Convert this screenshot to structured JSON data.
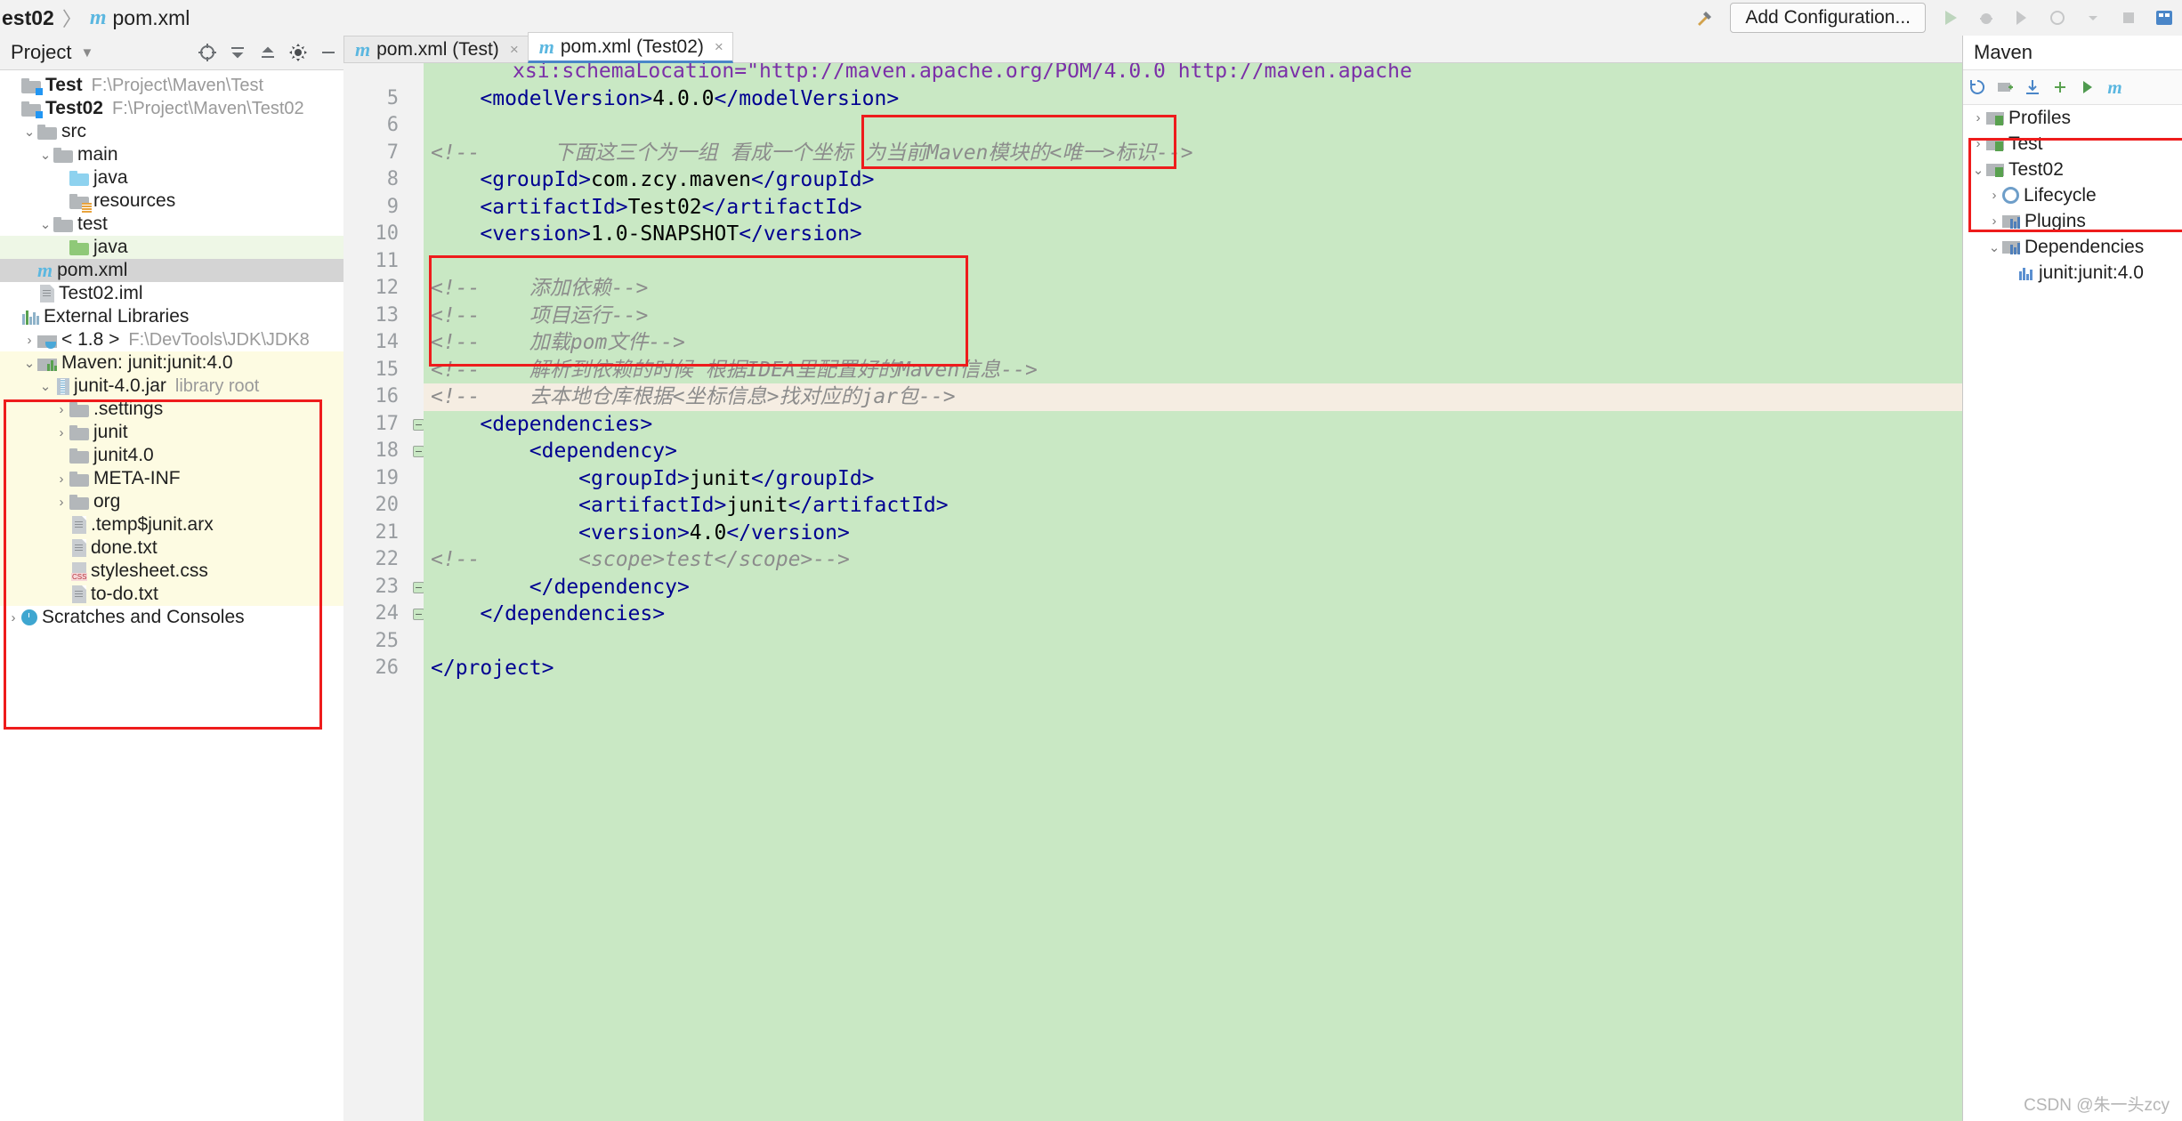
{
  "window": {
    "breadcrumb": {
      "project": "est02",
      "separator": "〉",
      "file": "pom.xml",
      "file_icon": "maven-m-icon"
    },
    "add_configuration_label": "Add Configuration...",
    "watermark": "CSDN @朱一头zcy"
  },
  "project_panel": {
    "title": "Project",
    "tree": [
      {
        "label": "Test",
        "path": "F:\\Project\\Maven\\Test",
        "icon": "module-folder-icon",
        "indent": 0,
        "arrow": "",
        "bold": true
      },
      {
        "label": "Test02",
        "path": "F:\\Project\\Maven\\Test02",
        "icon": "module-folder-icon",
        "indent": 0,
        "arrow": "",
        "bold": true
      },
      {
        "label": "src",
        "path": "",
        "icon": "folder-grey-icon",
        "indent": 1,
        "arrow": "⌄",
        "bold": false
      },
      {
        "label": "main",
        "path": "",
        "icon": "folder-grey-icon",
        "indent": 2,
        "arrow": "⌄",
        "bold": false
      },
      {
        "label": "java",
        "path": "",
        "icon": "folder-blue-icon",
        "indent": 3,
        "arrow": "",
        "bold": false
      },
      {
        "label": "resources",
        "path": "",
        "icon": "folder-resources-icon",
        "indent": 3,
        "arrow": "",
        "bold": false
      },
      {
        "label": "test",
        "path": "",
        "icon": "folder-grey-icon",
        "indent": 2,
        "arrow": "⌄",
        "bold": false
      },
      {
        "label": "java",
        "path": "",
        "icon": "folder-green-icon",
        "indent": 3,
        "arrow": "",
        "bold": false,
        "highlight": "green"
      },
      {
        "label": "pom.xml",
        "path": "",
        "icon": "maven-m-icon",
        "indent": 1,
        "arrow": "",
        "bold": false,
        "highlight": "grey"
      },
      {
        "label": "Test02.iml",
        "path": "",
        "icon": "iml-file-icon",
        "indent": 1,
        "arrow": "",
        "bold": false
      },
      {
        "label": "External Libraries",
        "path": "",
        "icon": "library-icon",
        "indent": 0,
        "arrow": "",
        "bold": false
      },
      {
        "label": "< 1.8 >",
        "path": "F:\\DevTools\\JDK\\JDK8",
        "icon": "jdk-icon",
        "indent": 1,
        "arrow": "›",
        "bold": false
      },
      {
        "label": "Maven: junit:junit:4.0",
        "path": "",
        "icon": "maven-lib-icon",
        "indent": 1,
        "arrow": "⌄",
        "bold": false,
        "highlight": "yellow"
      },
      {
        "label": "junit-4.0.jar",
        "path": "library root",
        "icon": "jar-icon",
        "indent": 2,
        "arrow": "⌄",
        "bold": false,
        "highlight": "yellow"
      },
      {
        "label": ".settings",
        "path": "",
        "icon": "folder-grey-icon",
        "indent": 3,
        "arrow": "›",
        "bold": false,
        "highlight": "yellow"
      },
      {
        "label": "junit",
        "path": "",
        "icon": "folder-grey-icon",
        "indent": 3,
        "arrow": "›",
        "bold": false,
        "highlight": "yellow"
      },
      {
        "label": "junit4.0",
        "path": "",
        "icon": "folder-grey-icon",
        "indent": 3,
        "arrow": "",
        "bold": false,
        "highlight": "yellow"
      },
      {
        "label": "META-INF",
        "path": "",
        "icon": "folder-grey-icon",
        "indent": 3,
        "arrow": "›",
        "bold": false,
        "highlight": "yellow"
      },
      {
        "label": "org",
        "path": "",
        "icon": "folder-grey-icon",
        "indent": 3,
        "arrow": "›",
        "bold": false,
        "highlight": "yellow"
      },
      {
        "label": ".temp$junit.arx",
        "path": "",
        "icon": "text-file-icon",
        "indent": 3,
        "arrow": "",
        "bold": false,
        "highlight": "yellow"
      },
      {
        "label": "done.txt",
        "path": "",
        "icon": "text-file-icon",
        "indent": 3,
        "arrow": "",
        "bold": false,
        "highlight": "yellow"
      },
      {
        "label": "stylesheet.css",
        "path": "",
        "icon": "css-file-icon",
        "indent": 3,
        "arrow": "",
        "bold": false,
        "highlight": "yellow"
      },
      {
        "label": "to-do.txt",
        "path": "",
        "icon": "text-file-icon",
        "indent": 3,
        "arrow": "",
        "bold": false,
        "highlight": "yellow"
      },
      {
        "label": "Scratches and Consoles",
        "path": "",
        "icon": "scratches-icon",
        "indent": 0,
        "arrow": "›",
        "bold": false
      }
    ],
    "toolbar_icons": [
      "locate-icon",
      "collapse-all-icon",
      "expand-all-icon",
      "settings-gear-icon",
      "hide-icon"
    ]
  },
  "editor": {
    "tabs": [
      {
        "label": "pom.xml (Test)",
        "icon": "maven-m-icon",
        "active": false,
        "close": "×"
      },
      {
        "label": "pom.xml (Test02)",
        "icon": "maven-m-icon",
        "active": true,
        "close": "×"
      }
    ],
    "inspection_ok": "✓",
    "lines": [
      {
        "n": "",
        "text": "xsi:schemaLocation=\"http://maven.apache.org/POM/4.0.0 http://maven.apache",
        "kind": "partial"
      },
      {
        "n": "5",
        "text": "<modelVersion>4.0.0</modelVersion>",
        "kind": "tag"
      },
      {
        "n": "6",
        "text": "",
        "kind": "blank"
      },
      {
        "n": "7",
        "text": "<!--      下面这三个为一组 看成一个坐标 为当前Maven模块的<唯一>标识-->",
        "kind": "comment"
      },
      {
        "n": "8",
        "text": "<groupId>com.zcy.maven</groupId>",
        "kind": "tag"
      },
      {
        "n": "9",
        "text": "<artifactId>Test02</artifactId>",
        "kind": "tag"
      },
      {
        "n": "10",
        "text": "<version>1.0-SNAPSHOT</version>",
        "kind": "tag"
      },
      {
        "n": "11",
        "text": "",
        "kind": "blank"
      },
      {
        "n": "12",
        "text": "<!--    添加依赖-->",
        "kind": "comment"
      },
      {
        "n": "13",
        "text": "<!--    项目运行-->",
        "kind": "comment"
      },
      {
        "n": "14",
        "text": "<!--    加载pom文件-->",
        "kind": "comment"
      },
      {
        "n": "15",
        "text": "<!--    解析到依赖的时候 根据IDEA里配置好的Maven信息-->",
        "kind": "comment"
      },
      {
        "n": "16",
        "text": "<!--    去本地仓库根据<坐标信息>找对应的jar包-->",
        "kind": "comment"
      },
      {
        "n": "17",
        "text": "<dependencies>",
        "kind": "tag"
      },
      {
        "n": "18",
        "text": "<dependency>",
        "kind": "tag"
      },
      {
        "n": "19",
        "text": "<groupId>junit</groupId>",
        "kind": "tag"
      },
      {
        "n": "20",
        "text": "<artifactId>junit</artifactId>",
        "kind": "tag"
      },
      {
        "n": "21",
        "text": "<version>4.0</version>",
        "kind": "tag"
      },
      {
        "n": "22",
        "text": "<!--        <scope>test</scope>-->",
        "kind": "comment"
      },
      {
        "n": "23",
        "text": "</dependency>",
        "kind": "tag"
      },
      {
        "n": "24",
        "text": "</dependencies>",
        "kind": "tag"
      },
      {
        "n": "25",
        "text": "",
        "kind": "blank"
      },
      {
        "n": "26",
        "text": "</project>",
        "kind": "tag"
      }
    ]
  },
  "maven_panel": {
    "title": "Maven",
    "toolbar_icons": [
      "reload-icon",
      "add-folder-icon",
      "download-icon",
      "plus-icon",
      "run-icon",
      "maven-m-icon"
    ],
    "tree": [
      {
        "label": "Profiles",
        "icon": "profiles-icon",
        "indent": 0,
        "arrow": "›"
      },
      {
        "label": "Test",
        "icon": "maven-project-icon",
        "indent": 0,
        "arrow": "›"
      },
      {
        "label": "Test02",
        "icon": "maven-project-icon",
        "indent": 0,
        "arrow": "⌄"
      },
      {
        "label": "Lifecycle",
        "icon": "lifecycle-icon",
        "indent": 1,
        "arrow": "›"
      },
      {
        "label": "Plugins",
        "icon": "plugins-icon",
        "indent": 1,
        "arrow": "›"
      },
      {
        "label": "Dependencies",
        "icon": "dependencies-icon",
        "indent": 1,
        "arrow": "⌄"
      },
      {
        "label": "junit:junit:4.0",
        "icon": "dependency-bars-icon",
        "indent": 2,
        "arrow": ""
      }
    ]
  },
  "colors": {
    "editor_bg": "#c9e8c4",
    "annotation_red": "#ee1c1c",
    "tag_blue": "#000091",
    "comment_grey": "#8c8c8c",
    "accent_blue": "#4a86c8"
  }
}
